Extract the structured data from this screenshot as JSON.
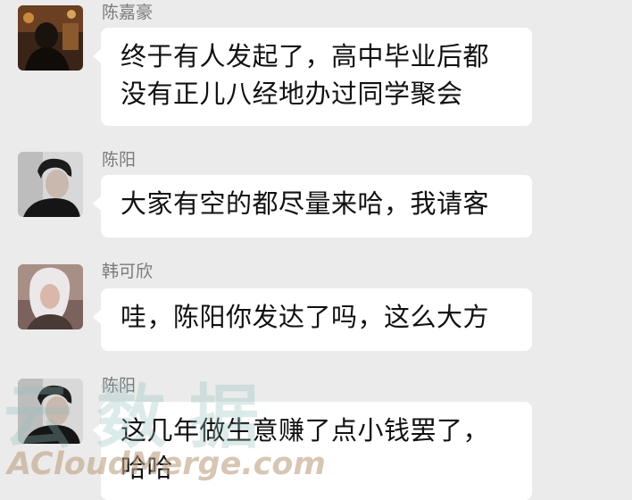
{
  "messages": [
    {
      "sender": "陈嘉豪",
      "lines": [
        "终于有人发起了，高中毕业后都",
        "没有正儿八经地办过同学聚会"
      ]
    },
    {
      "sender": "陈阳",
      "lines": [
        "大家有空的都尽量来哈，我请客"
      ]
    },
    {
      "sender": "韩可欣",
      "lines": [
        "哇，陈阳你发达了吗，这么大方"
      ]
    },
    {
      "sender": "陈阳",
      "lines": [
        "这几年做生意赚了点小钱罢了，",
        "哈哈"
      ]
    }
  ],
  "watermark": {
    "latin": "ACloudMerge.com"
  }
}
